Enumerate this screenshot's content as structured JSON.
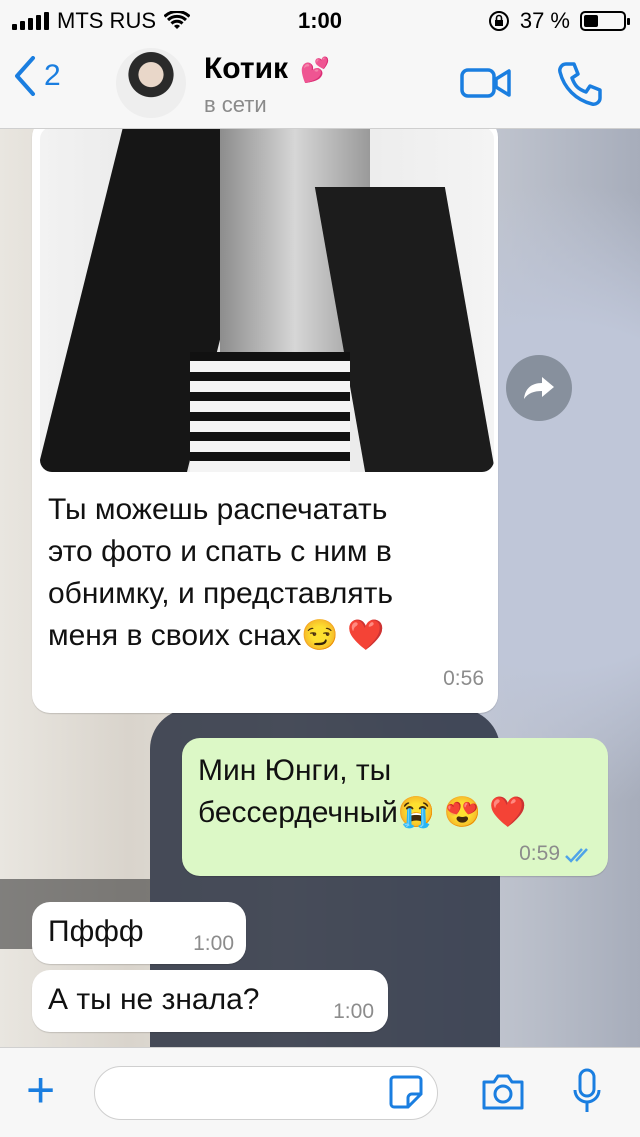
{
  "status_bar": {
    "carrier": "MTS RUS",
    "time": "1:00",
    "battery": "37 %",
    "battery_level": 0.37
  },
  "header": {
    "back_count": "2",
    "contact_name": "Котик",
    "contact_emoji": "💕",
    "status": "в сети"
  },
  "messages": [
    {
      "direction": "incoming",
      "has_photo": true,
      "lines": [
        "Ты можешь распечатать",
        "это фото и спать с ним в",
        "обнимку, и представлять",
        "меня в своих снах😏 ❤️"
      ],
      "time": "0:56"
    },
    {
      "direction": "outgoing",
      "lines": [
        "Мин Юнги, ты",
        "бессердечный😭 😍 ❤️"
      ],
      "time": "0:59",
      "read_status": "read"
    },
    {
      "direction": "incoming",
      "lines": [
        "Пффф"
      ],
      "time": "1:00"
    },
    {
      "direction": "incoming",
      "lines": [
        "А ты не знала?"
      ],
      "time": "1:00"
    }
  ],
  "input": {
    "placeholder": ""
  },
  "colors": {
    "accent": "#1a7ee0",
    "outgoing_bubble": "#dcf8c6",
    "incoming_bubble": "#ffffff",
    "read_ticks": "#4fa3e8"
  },
  "icons": [
    "signal-bars-icon",
    "wifi-icon",
    "lock-rotation-icon",
    "battery-icon",
    "back-chevron-icon",
    "video-call-icon",
    "phone-icon",
    "forward-icon",
    "double-check-icon",
    "plus-icon",
    "sticker-icon",
    "camera-icon",
    "microphone-icon"
  ]
}
